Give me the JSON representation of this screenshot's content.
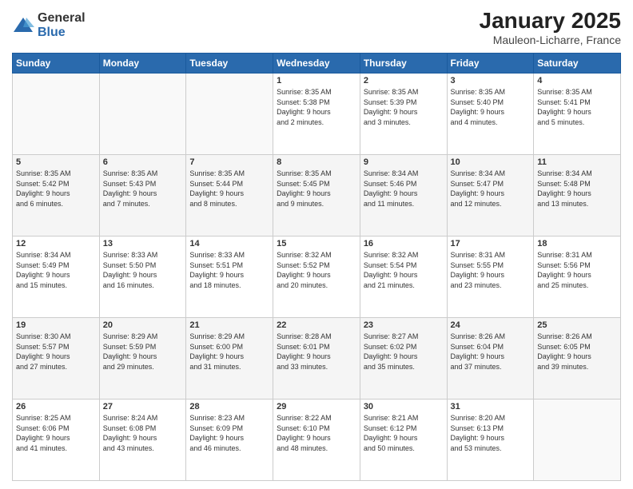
{
  "logo": {
    "general": "General",
    "blue": "Blue"
  },
  "title": "January 2025",
  "location": "Mauleon-Licharre, France",
  "weekdays": [
    "Sunday",
    "Monday",
    "Tuesday",
    "Wednesday",
    "Thursday",
    "Friday",
    "Saturday"
  ],
  "rows": [
    [
      {
        "day": "",
        "info": ""
      },
      {
        "day": "",
        "info": ""
      },
      {
        "day": "",
        "info": ""
      },
      {
        "day": "1",
        "info": "Sunrise: 8:35 AM\nSunset: 5:38 PM\nDaylight: 9 hours\nand 2 minutes."
      },
      {
        "day": "2",
        "info": "Sunrise: 8:35 AM\nSunset: 5:39 PM\nDaylight: 9 hours\nand 3 minutes."
      },
      {
        "day": "3",
        "info": "Sunrise: 8:35 AM\nSunset: 5:40 PM\nDaylight: 9 hours\nand 4 minutes."
      },
      {
        "day": "4",
        "info": "Sunrise: 8:35 AM\nSunset: 5:41 PM\nDaylight: 9 hours\nand 5 minutes."
      }
    ],
    [
      {
        "day": "5",
        "info": "Sunrise: 8:35 AM\nSunset: 5:42 PM\nDaylight: 9 hours\nand 6 minutes."
      },
      {
        "day": "6",
        "info": "Sunrise: 8:35 AM\nSunset: 5:43 PM\nDaylight: 9 hours\nand 7 minutes."
      },
      {
        "day": "7",
        "info": "Sunrise: 8:35 AM\nSunset: 5:44 PM\nDaylight: 9 hours\nand 8 minutes."
      },
      {
        "day": "8",
        "info": "Sunrise: 8:35 AM\nSunset: 5:45 PM\nDaylight: 9 hours\nand 9 minutes."
      },
      {
        "day": "9",
        "info": "Sunrise: 8:34 AM\nSunset: 5:46 PM\nDaylight: 9 hours\nand 11 minutes."
      },
      {
        "day": "10",
        "info": "Sunrise: 8:34 AM\nSunset: 5:47 PM\nDaylight: 9 hours\nand 12 minutes."
      },
      {
        "day": "11",
        "info": "Sunrise: 8:34 AM\nSunset: 5:48 PM\nDaylight: 9 hours\nand 13 minutes."
      }
    ],
    [
      {
        "day": "12",
        "info": "Sunrise: 8:34 AM\nSunset: 5:49 PM\nDaylight: 9 hours\nand 15 minutes."
      },
      {
        "day": "13",
        "info": "Sunrise: 8:33 AM\nSunset: 5:50 PM\nDaylight: 9 hours\nand 16 minutes."
      },
      {
        "day": "14",
        "info": "Sunrise: 8:33 AM\nSunset: 5:51 PM\nDaylight: 9 hours\nand 18 minutes."
      },
      {
        "day": "15",
        "info": "Sunrise: 8:32 AM\nSunset: 5:52 PM\nDaylight: 9 hours\nand 20 minutes."
      },
      {
        "day": "16",
        "info": "Sunrise: 8:32 AM\nSunset: 5:54 PM\nDaylight: 9 hours\nand 21 minutes."
      },
      {
        "day": "17",
        "info": "Sunrise: 8:31 AM\nSunset: 5:55 PM\nDaylight: 9 hours\nand 23 minutes."
      },
      {
        "day": "18",
        "info": "Sunrise: 8:31 AM\nSunset: 5:56 PM\nDaylight: 9 hours\nand 25 minutes."
      }
    ],
    [
      {
        "day": "19",
        "info": "Sunrise: 8:30 AM\nSunset: 5:57 PM\nDaylight: 9 hours\nand 27 minutes."
      },
      {
        "day": "20",
        "info": "Sunrise: 8:29 AM\nSunset: 5:59 PM\nDaylight: 9 hours\nand 29 minutes."
      },
      {
        "day": "21",
        "info": "Sunrise: 8:29 AM\nSunset: 6:00 PM\nDaylight: 9 hours\nand 31 minutes."
      },
      {
        "day": "22",
        "info": "Sunrise: 8:28 AM\nSunset: 6:01 PM\nDaylight: 9 hours\nand 33 minutes."
      },
      {
        "day": "23",
        "info": "Sunrise: 8:27 AM\nSunset: 6:02 PM\nDaylight: 9 hours\nand 35 minutes."
      },
      {
        "day": "24",
        "info": "Sunrise: 8:26 AM\nSunset: 6:04 PM\nDaylight: 9 hours\nand 37 minutes."
      },
      {
        "day": "25",
        "info": "Sunrise: 8:26 AM\nSunset: 6:05 PM\nDaylight: 9 hours\nand 39 minutes."
      }
    ],
    [
      {
        "day": "26",
        "info": "Sunrise: 8:25 AM\nSunset: 6:06 PM\nDaylight: 9 hours\nand 41 minutes."
      },
      {
        "day": "27",
        "info": "Sunrise: 8:24 AM\nSunset: 6:08 PM\nDaylight: 9 hours\nand 43 minutes."
      },
      {
        "day": "28",
        "info": "Sunrise: 8:23 AM\nSunset: 6:09 PM\nDaylight: 9 hours\nand 46 minutes."
      },
      {
        "day": "29",
        "info": "Sunrise: 8:22 AM\nSunset: 6:10 PM\nDaylight: 9 hours\nand 48 minutes."
      },
      {
        "day": "30",
        "info": "Sunrise: 8:21 AM\nSunset: 6:12 PM\nDaylight: 9 hours\nand 50 minutes."
      },
      {
        "day": "31",
        "info": "Sunrise: 8:20 AM\nSunset: 6:13 PM\nDaylight: 9 hours\nand 53 minutes."
      },
      {
        "day": "",
        "info": ""
      }
    ]
  ]
}
